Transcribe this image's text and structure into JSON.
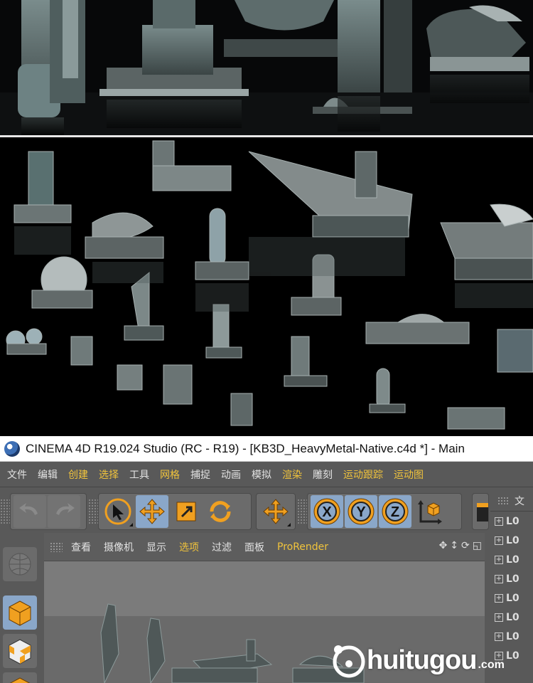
{
  "title_bar": {
    "text": "CINEMA 4D R19.024 Studio (RC - R19) - [KB3D_HeavyMetal-Native.c4d *] - Main"
  },
  "menu": [
    {
      "label": "文件",
      "accent": false
    },
    {
      "label": "编辑",
      "accent": false
    },
    {
      "label": "创建",
      "accent": true
    },
    {
      "label": "选择",
      "accent": true
    },
    {
      "label": "工具",
      "accent": false
    },
    {
      "label": "网格",
      "accent": true
    },
    {
      "label": "捕捉",
      "accent": false
    },
    {
      "label": "动画",
      "accent": false
    },
    {
      "label": "模拟",
      "accent": false
    },
    {
      "label": "渲染",
      "accent": true
    },
    {
      "label": "雕刻",
      "accent": false
    },
    {
      "label": "运动跟踪",
      "accent": true
    },
    {
      "label": "运动图",
      "accent": true
    }
  ],
  "toolbar": {
    "axis_x": "X",
    "axis_y": "Y",
    "axis_z": "Z"
  },
  "viewport": {
    "menu": [
      {
        "label": "查看",
        "accent": false
      },
      {
        "label": "摄像机",
        "accent": false
      },
      {
        "label": "显示",
        "accent": false
      },
      {
        "label": "选项",
        "accent": true
      },
      {
        "label": "过滤",
        "accent": false
      },
      {
        "label": "面板",
        "accent": false
      },
      {
        "label": "ProRender",
        "accent": true
      }
    ]
  },
  "object_panel": {
    "header": "文",
    "rows": [
      "L0",
      "L0",
      "L0",
      "L0",
      "L0",
      "L0",
      "L0",
      "L0"
    ]
  },
  "watermark": {
    "text": "huitugou",
    "suffix": ".com"
  },
  "colors": {
    "accent": "#f0c33c",
    "active": "#8aa7c9",
    "ui_bg": "#595959",
    "icon_orange": "#f0a020"
  }
}
